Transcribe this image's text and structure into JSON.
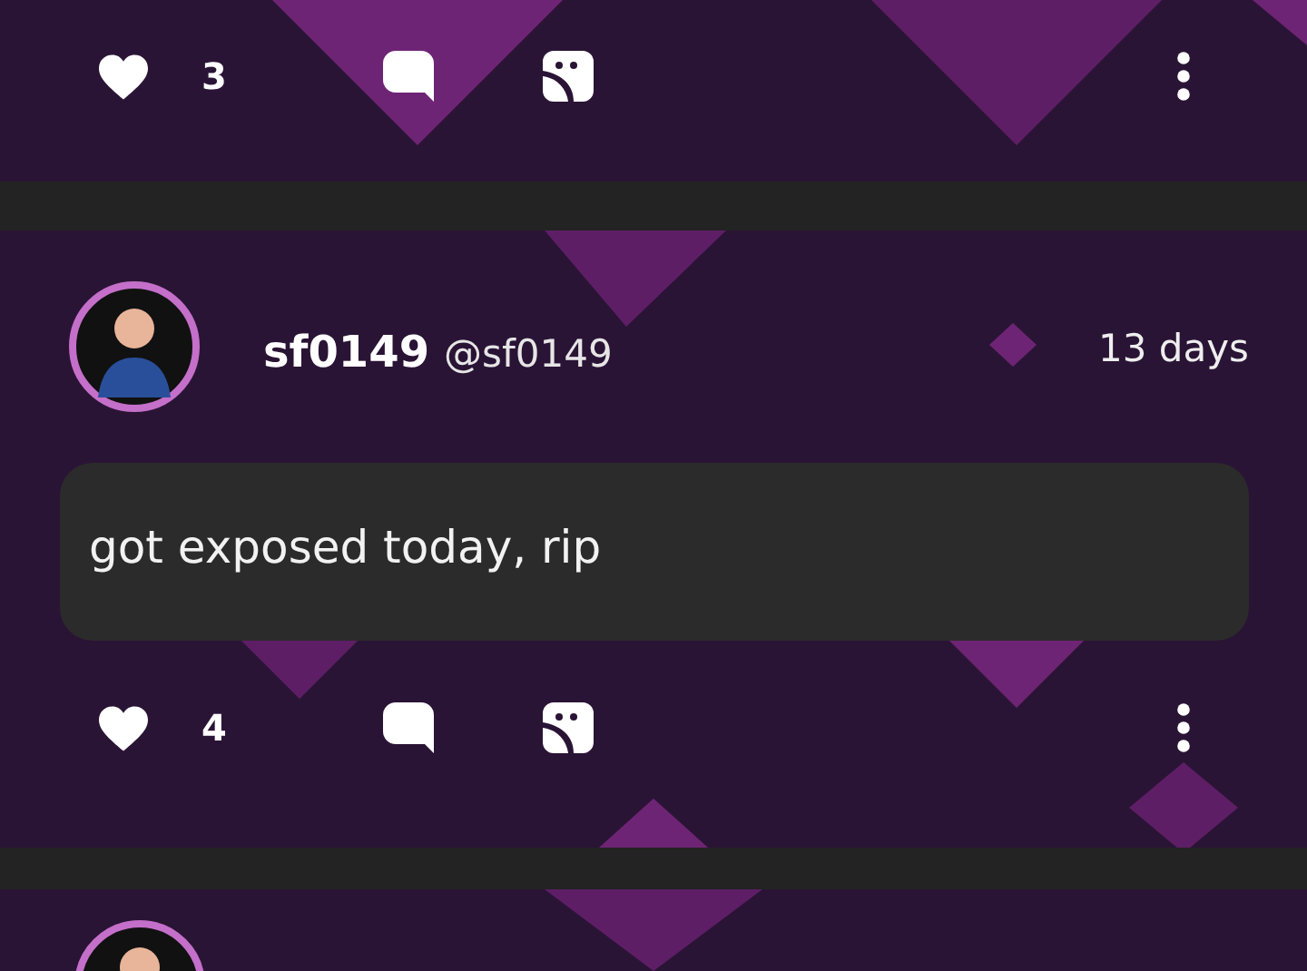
{
  "previous_post": {
    "likes": "3"
  },
  "post": {
    "author": {
      "name": "sf0149",
      "handle": "@sf0149"
    },
    "time": "13 days",
    "text": "got exposed today, rip",
    "likes": "4"
  }
}
